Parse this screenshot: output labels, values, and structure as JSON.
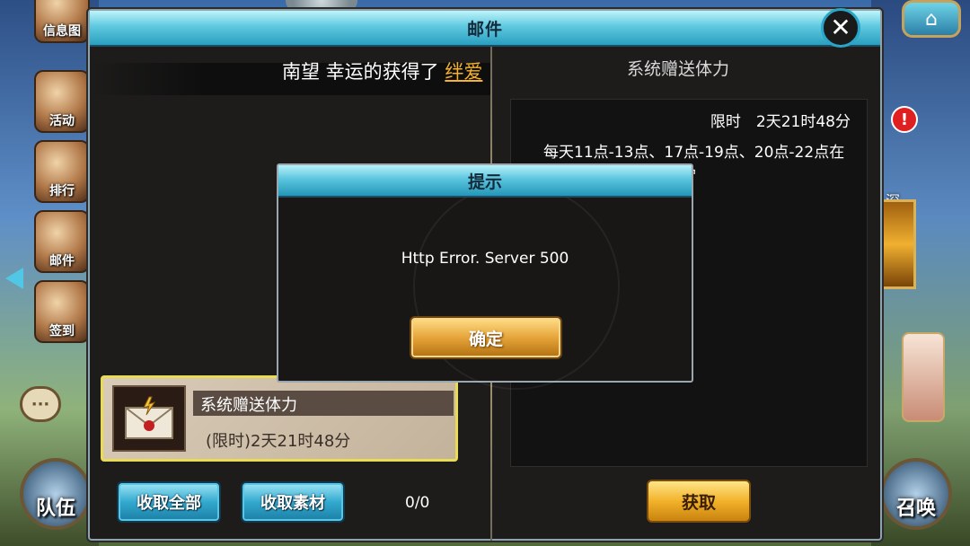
{
  "sidebar_left": {
    "items": [
      {
        "label": "信息图"
      },
      {
        "label": "活动"
      },
      {
        "label": "排行"
      },
      {
        "label": "邮件"
      },
      {
        "label": "签到"
      }
    ],
    "bottom_label": "队伍"
  },
  "sidebar_right": {
    "partial_label": "深",
    "badge": "!",
    "bottom_label": "召唤"
  },
  "mail_window": {
    "title": "邮件",
    "close_label": "✕",
    "announcement": {
      "prefix": "南望 幸运的获得了 ",
      "highlight": "绊爱"
    },
    "detail": {
      "header": "系统赠送体力",
      "limit_text": "限时　2天21时48分",
      "description": "每天11点-13点、17点-19点、20点-22点在线，所获得的体力奖励"
    },
    "list": [
      {
        "title": "系统赠送体力",
        "time": "(限时)2天21时48分",
        "icon": "envelope-icon"
      }
    ],
    "buttons": {
      "collect_all": "收取全部",
      "collect_material": "收取素材",
      "count": "0/0",
      "obtain": "获取"
    }
  },
  "dialog": {
    "title": "提示",
    "message": "Http Error. Server 500",
    "confirm": "确定"
  },
  "colors": {
    "accent_cyan": "#2a9fbf",
    "highlight_gold": "#f5b330",
    "item_border": "#e8dc57",
    "panel_bg": "#1d1c1b"
  }
}
